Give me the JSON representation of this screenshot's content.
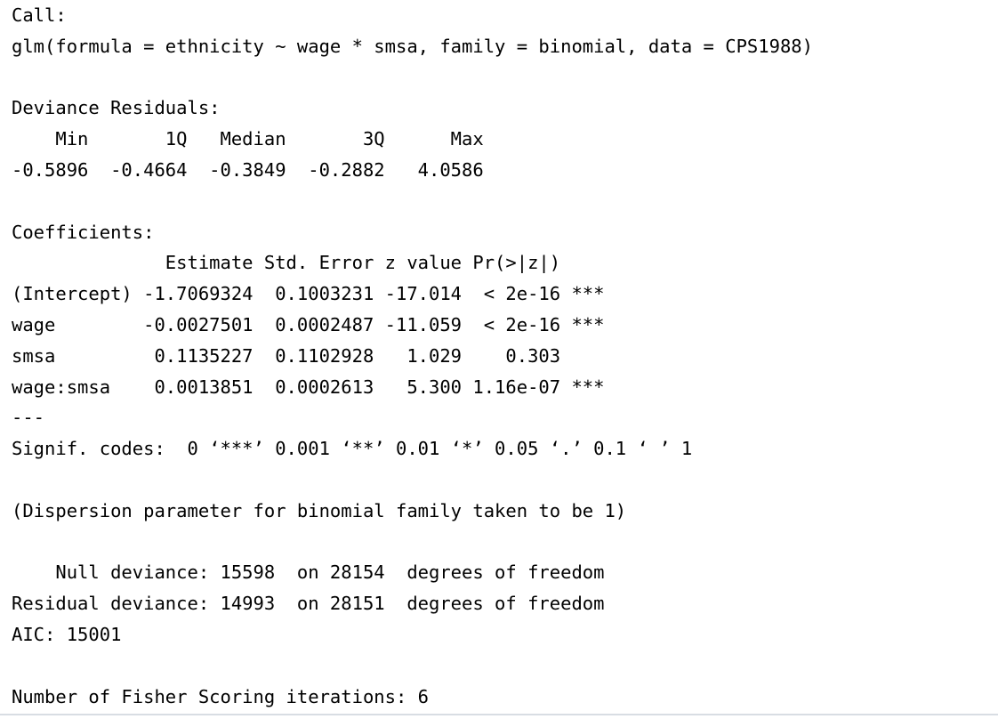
{
  "console": {
    "lines": [
      "Call:",
      "glm(formula = ethnicity ~ wage * smsa, family = binomial, data = CPS1988)",
      "",
      "Deviance Residuals:",
      "    Min       1Q   Median       3Q      Max",
      "-0.5896  -0.4664  -0.3849  -0.2882   4.0586",
      "",
      "Coefficients:",
      "              Estimate Std. Error z value Pr(>|z|)",
      "(Intercept) -1.7069324  0.1003231 -17.014  < 2e-16 ***",
      "wage        -0.0027501  0.0002487 -11.059  < 2e-16 ***",
      "smsa         0.1135227  0.1102928   1.029    0.303",
      "wage:smsa    0.0013851  0.0002613   5.300 1.16e-07 ***",
      "---",
      "Signif. codes:  0 ‘***’ 0.001 ‘**’ 0.01 ‘*’ 0.05 ‘.’ 0.1 ‘ ’ 1",
      "",
      "(Dispersion parameter for binomial family taken to be 1)",
      "",
      "    Null deviance: 15598  on 28154  degrees of freedom",
      "Residual deviance: 14993  on 28151  degrees of freedom",
      "AIC: 15001",
      "",
      "Number of Fisher Scoring iterations: 6"
    ]
  }
}
